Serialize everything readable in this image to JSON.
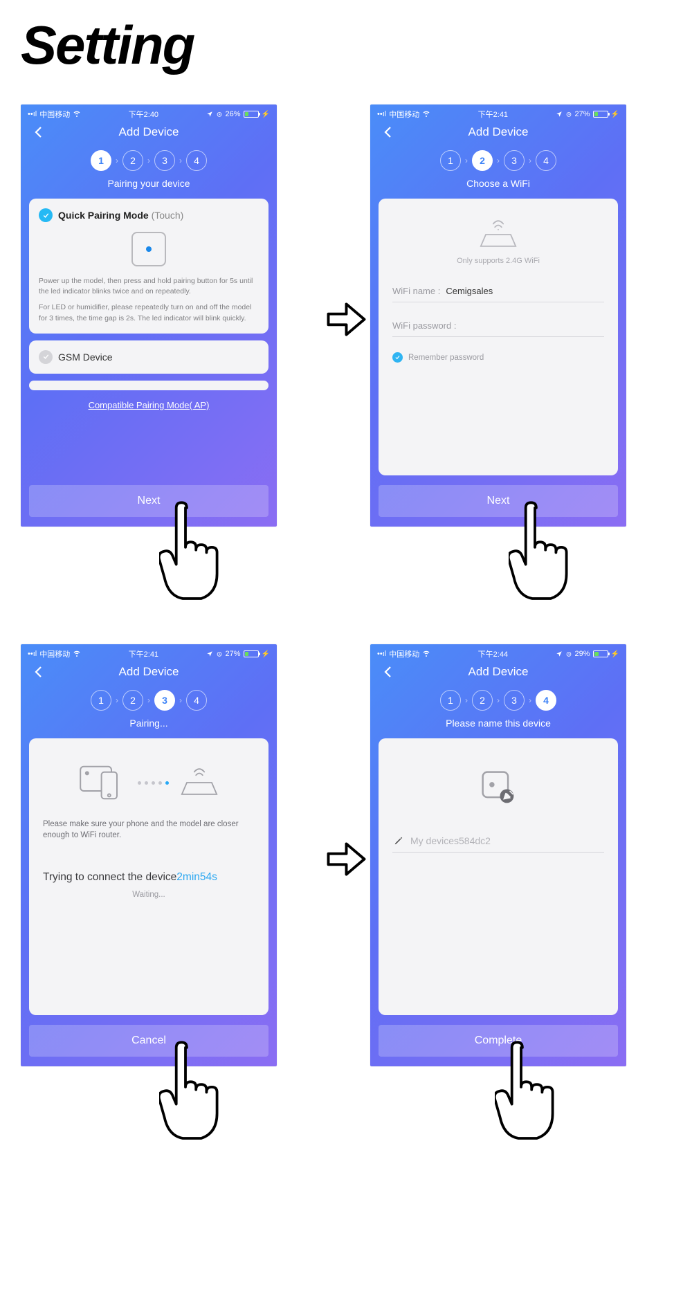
{
  "page_title": "Setting",
  "screens": {
    "s1": {
      "status": {
        "carrier": "中国移动",
        "time": "下午2:40",
        "battery": "26%"
      },
      "header": "Add Device",
      "active_step": 1,
      "subtitle": "Pairing your device",
      "qp_title": "Quick Pairing Mode",
      "qp_touch": "(Touch)",
      "qp_para1": "Power up the model, then press and hold pairing button for 5s until the led indicator blinks twice and on repeatedly.",
      "qp_para2": "For LED or humidifier, please repeatedly turn on and off the model for 3 times, the time gap is 2s. The led indicator will blink quickly.",
      "gsm": "GSM Device",
      "compat": "Compatible Pairing Mode( AP)",
      "btn": "Next"
    },
    "s2": {
      "status": {
        "carrier": "中国移动",
        "time": "下午2:41",
        "battery": "27%"
      },
      "header": "Add Device",
      "active_step": 2,
      "subtitle": "Choose a WiFi",
      "support": "Only supports 2.4G WiFi",
      "wifi_name_label": "WiFi name :",
      "wifi_name_value": "Cemigsales",
      "wifi_pwd_label": "WiFi password :",
      "remember": "Remember password",
      "btn": "Next"
    },
    "s3": {
      "status": {
        "carrier": "中国移动",
        "time": "下午2:41",
        "battery": "27%"
      },
      "header": "Add Device",
      "active_step": 3,
      "subtitle": "Pairing...",
      "note": "Please make sure your phone and the model are closer enough to WiFi router.",
      "try": "Trying to connect the device",
      "try_time": "2min54s",
      "waiting": "Waiting...",
      "btn": "Cancel"
    },
    "s4": {
      "status": {
        "carrier": "中国移动",
        "time": "下午2:44",
        "battery": "29%"
      },
      "header": "Add Device",
      "active_step": 4,
      "subtitle": "Please name this device",
      "device_name": "My devices584dc2",
      "btn": "Complete"
    }
  }
}
